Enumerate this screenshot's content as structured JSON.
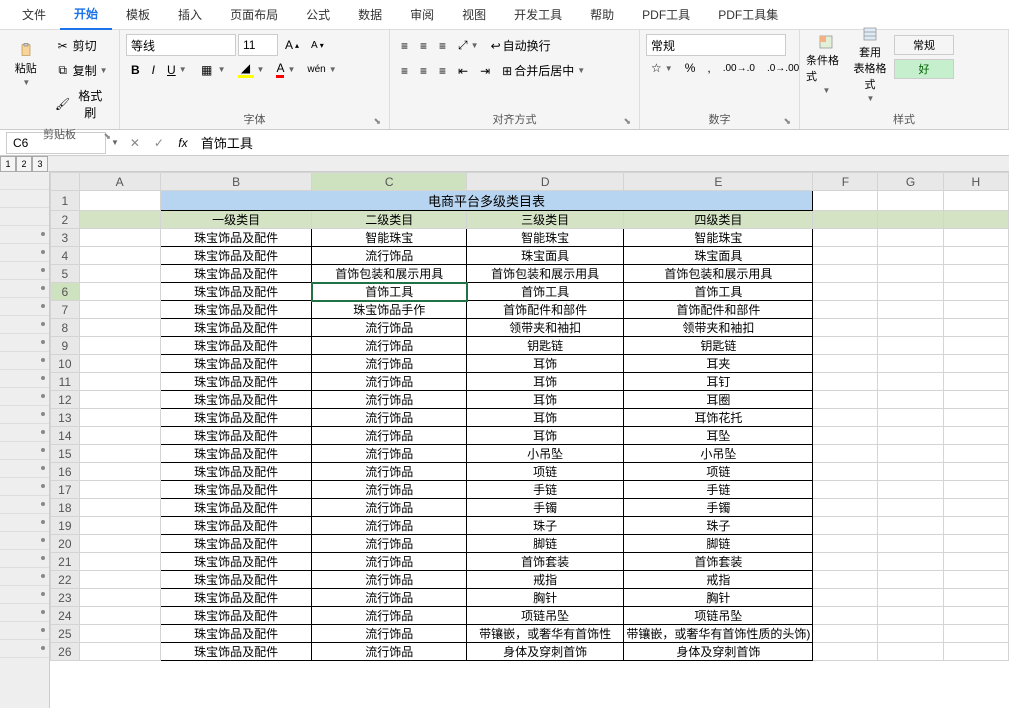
{
  "menu": {
    "tabs": [
      "文件",
      "开始",
      "模板",
      "插入",
      "页面布局",
      "公式",
      "数据",
      "审阅",
      "视图",
      "开发工具",
      "帮助",
      "PDF工具",
      "PDF工具集"
    ],
    "active": 1
  },
  "ribbon": {
    "clipboard": {
      "paste": "粘贴",
      "cut": "剪切",
      "copy": "复制",
      "format_painter": "格式刷",
      "label": "剪贴板"
    },
    "font": {
      "name": "等线",
      "size": "11",
      "label": "字体"
    },
    "align": {
      "wrap": "自动换行",
      "merge": "合并后居中",
      "label": "对齐方式"
    },
    "number": {
      "format": "常规",
      "label": "数字"
    },
    "styles": {
      "cond": "条件格式",
      "table": "套用\n表格格式",
      "normal": "常规",
      "good": "好",
      "label": "样式"
    }
  },
  "namebox": "C6",
  "formula": "首饰工具",
  "outline": [
    "1",
    "2",
    "3"
  ],
  "cols": [
    "A",
    "B",
    "C",
    "D",
    "E",
    "F",
    "G",
    "H"
  ],
  "title": "电商平台多级类目表",
  "headers": [
    "一级类目",
    "二级类目",
    "三级类目",
    "四级类目"
  ],
  "rows": [
    [
      "珠宝饰品及配件",
      "智能珠宝",
      "智能珠宝",
      "智能珠宝"
    ],
    [
      "珠宝饰品及配件",
      "流行饰品",
      "珠宝面具",
      "珠宝面具"
    ],
    [
      "珠宝饰品及配件",
      "首饰包装和展示用具",
      "首饰包装和展示用具",
      "首饰包装和展示用具"
    ],
    [
      "珠宝饰品及配件",
      "首饰工具",
      "首饰工具",
      "首饰工具"
    ],
    [
      "珠宝饰品及配件",
      "珠宝饰品手作",
      "首饰配件和部件",
      "首饰配件和部件"
    ],
    [
      "珠宝饰品及配件",
      "流行饰品",
      "领带夹和袖扣",
      "领带夹和袖扣"
    ],
    [
      "珠宝饰品及配件",
      "流行饰品",
      "钥匙链",
      "钥匙链"
    ],
    [
      "珠宝饰品及配件",
      "流行饰品",
      "耳饰",
      "耳夹"
    ],
    [
      "珠宝饰品及配件",
      "流行饰品",
      "耳饰",
      "耳钉"
    ],
    [
      "珠宝饰品及配件",
      "流行饰品",
      "耳饰",
      "耳圈"
    ],
    [
      "珠宝饰品及配件",
      "流行饰品",
      "耳饰",
      "耳饰花托"
    ],
    [
      "珠宝饰品及配件",
      "流行饰品",
      "耳饰",
      "耳坠"
    ],
    [
      "珠宝饰品及配件",
      "流行饰品",
      "小吊坠",
      "小吊坠"
    ],
    [
      "珠宝饰品及配件",
      "流行饰品",
      "项链",
      "项链"
    ],
    [
      "珠宝饰品及配件",
      "流行饰品",
      "手链",
      "手链"
    ],
    [
      "珠宝饰品及配件",
      "流行饰品",
      "手镯",
      "手镯"
    ],
    [
      "珠宝饰品及配件",
      "流行饰品",
      "珠子",
      "珠子"
    ],
    [
      "珠宝饰品及配件",
      "流行饰品",
      "脚链",
      "脚链"
    ],
    [
      "珠宝饰品及配件",
      "流行饰品",
      "首饰套装",
      "首饰套装"
    ],
    [
      "珠宝饰品及配件",
      "流行饰品",
      "戒指",
      "戒指"
    ],
    [
      "珠宝饰品及配件",
      "流行饰品",
      "胸针",
      "胸针"
    ],
    [
      "珠宝饰品及配件",
      "流行饰品",
      "项链吊坠",
      "项链吊坠"
    ],
    [
      "珠宝饰品及配件",
      "流行饰品",
      "带镶嵌，或奢华有首饰性",
      "带镶嵌，或奢华有首饰性质的头饰)"
    ],
    [
      "珠宝饰品及配件",
      "流行饰品",
      "身体及穿刺首饰",
      "身体及穿刺首饰"
    ]
  ],
  "selected": {
    "row": 6,
    "col": "C"
  }
}
